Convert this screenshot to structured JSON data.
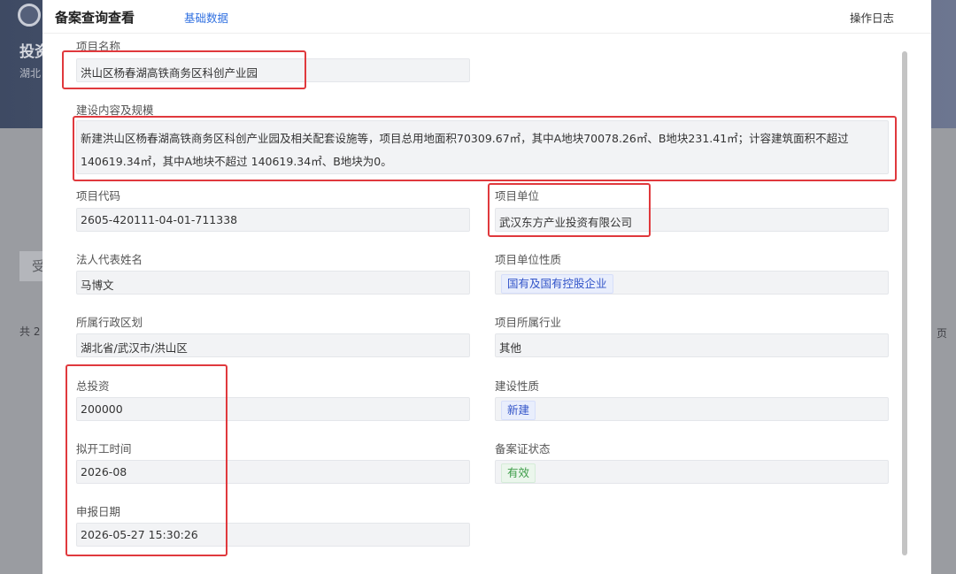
{
  "background": {
    "banner_title": "投资",
    "banner_sub": "湖北",
    "tab_label": "受",
    "total_text": "共 2",
    "page_text": "页"
  },
  "dialog": {
    "title": "备案查询查看",
    "tab_basic": "基础数据",
    "op_log": "操作日志"
  },
  "fields": {
    "project_name": {
      "label": "项目名称",
      "value": "洪山区杨春湖高铁商务区科创产业园"
    },
    "construction": {
      "label": "建设内容及规模",
      "value": "新建洪山区杨春湖高铁商务区科创产业园及相关配套设施等，项目总用地面积70309.67㎡，其中A地块70078.26㎡、B地块231.41㎡；计容建筑面积不超过140619.34㎡，其中A地块不超过 140619.34㎡、B地块为0。"
    },
    "project_code": {
      "label": "项目代码",
      "value": "2605-420111-04-01-711338"
    },
    "project_unit": {
      "label": "项目单位",
      "value": "武汉东方产业投资有限公司"
    },
    "legal_rep": {
      "label": "法人代表姓名",
      "value": "马博文"
    },
    "unit_nature": {
      "label": "项目单位性质",
      "value": "国有及国有控股企业"
    },
    "region": {
      "label": "所属行政区划",
      "value": "湖北省/武汉市/洪山区"
    },
    "industry": {
      "label": "项目所属行业",
      "value": "其他"
    },
    "total_investment": {
      "label": "总投资",
      "value": "200000"
    },
    "build_nature": {
      "label": "建设性质",
      "value": "新建"
    },
    "planned_start": {
      "label": "拟开工时间",
      "value": "2026-08"
    },
    "record_status": {
      "label": "备案证状态",
      "value": "有效"
    },
    "report_date": {
      "label": "申报日期",
      "value": "2026-05-27 15:30:26"
    }
  },
  "colors": {
    "highlight": "#e0393d",
    "link": "#2f6fe0",
    "tag_blue": "#3355c9",
    "tag_green": "#3f9d4a"
  }
}
